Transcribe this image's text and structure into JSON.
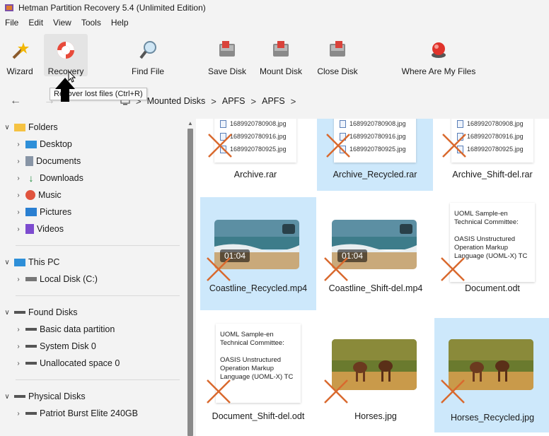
{
  "window": {
    "title": "Hetman Partition Recovery 5.4 (Unlimited Edition)"
  },
  "menu": [
    "File",
    "Edit",
    "View",
    "Tools",
    "Help"
  ],
  "toolbar": {
    "wizard": "Wizard",
    "recovery": "Recovery",
    "find_file": "Find File",
    "save_disk": "Save Disk",
    "mount_disk": "Mount Disk",
    "close_disk": "Close Disk",
    "where_files": "Where Are My Files"
  },
  "tooltip": "Recover lost files (Ctrl+R)",
  "breadcrumb": [
    "Mounted Disks",
    "APFS",
    "APFS"
  ],
  "sidebar": {
    "folders": "Folders",
    "folder_items": [
      "Desktop",
      "Documents",
      "Downloads",
      "Music",
      "Pictures",
      "Videos"
    ],
    "this_pc": "This PC",
    "this_pc_items": [
      "Local Disk (C:)"
    ],
    "found_disks": "Found Disks",
    "found_items": [
      "Basic data partition",
      "System Disk 0",
      "Unallocated space 0"
    ],
    "physical_disks": "Physical Disks",
    "physical_items": [
      "Patriot Burst Elite 240GB"
    ]
  },
  "archive_files": [
    "1689920780908.jpg",
    "1689920780916.jpg",
    "1689920780925.jpg"
  ],
  "video_time": "01:04",
  "doc_text": {
    "line1": "UOML Sample-en Technical Committee:",
    "line2": "OASIS Unstructured Operation Markup Language (UOML-X) TC"
  },
  "files": [
    "Archive.rar",
    "Archive_Recycled.rar",
    "Archive_Shift-del.rar",
    "Coastline_Recycled.mp4",
    "Coastline_Shift-del.mp4",
    "Document.odt",
    "Document_Shift-del.odt",
    "Horses.jpg",
    "Horses_Recycled.jpg"
  ],
  "colors": {
    "selection": "#cde8fb",
    "deleted_mark": "#d9692e",
    "accent": "#0078d4"
  }
}
